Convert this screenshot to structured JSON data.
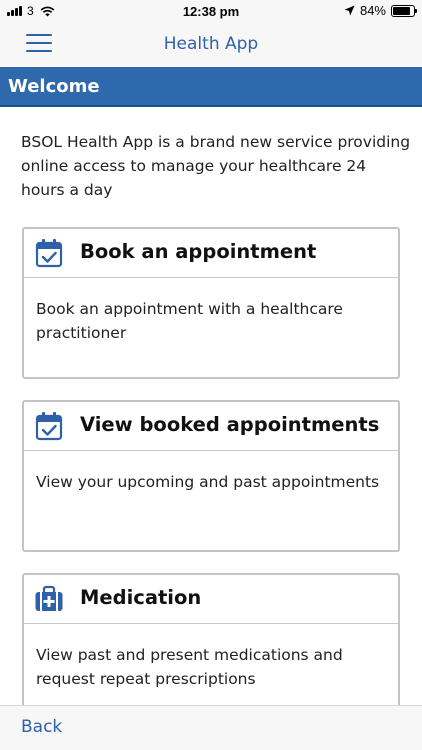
{
  "status_bar": {
    "carrier": "3",
    "time": "12:38 pm",
    "battery_percent": "84%",
    "battery_level": 0.84,
    "icons": [
      "signal-icon",
      "wifi-icon",
      "location-arrow-icon",
      "battery-icon"
    ]
  },
  "nav": {
    "title": "Health App",
    "menu_icon": "hamburger-menu-icon"
  },
  "banner": {
    "title": "Welcome"
  },
  "intro": "BSOL Health App is a brand new service providing online access to manage your healthcare 24 hours a day",
  "cards": [
    {
      "title": "Book an appointment",
      "description": "Book an appointment with a healthcare practitioner",
      "icon": "calendar-check-icon"
    },
    {
      "title": "View booked appointments",
      "description": "View your upcoming and past appointments",
      "icon": "calendar-check-icon"
    },
    {
      "title": "Medication",
      "description": "View past and present medications and request repeat prescriptions",
      "icon": "medical-kit-icon"
    }
  ],
  "bottom_bar": {
    "back_label": "Back"
  },
  "colors": {
    "accent": "#2f61a8",
    "banner": "#2f69ad",
    "card_border": "#c4c4c4"
  }
}
